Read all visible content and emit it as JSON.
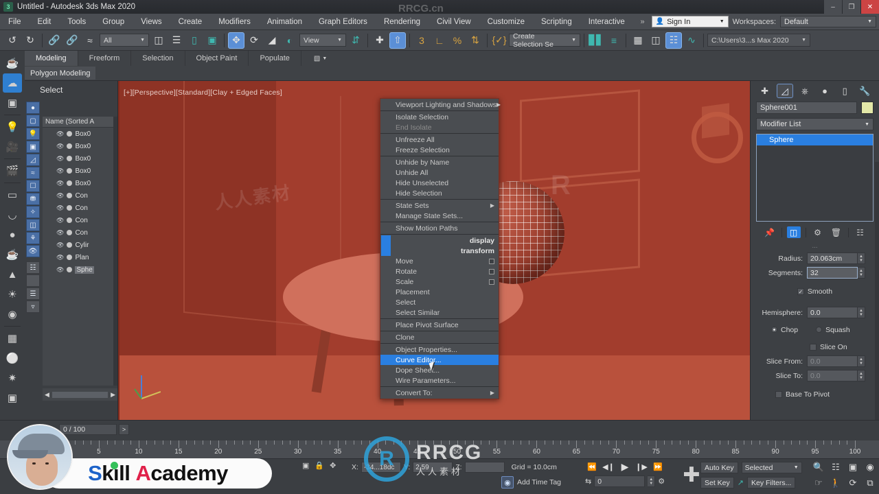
{
  "window": {
    "title": "Untitled - Autodesk 3ds Max 2020",
    "app_icon": "3",
    "minimize": "–",
    "maximize": "❐",
    "close": "✕"
  },
  "menubar": {
    "items": [
      "File",
      "Edit",
      "Tools",
      "Group",
      "Views",
      "Create",
      "Modifiers",
      "Animation",
      "Graph Editors",
      "Rendering",
      "Civil View",
      "Customize",
      "Scripting",
      "Interactive"
    ],
    "overflow": "»",
    "sign_in": "Sign In",
    "workspaces_label": "Workspaces:",
    "workspace_value": "Default"
  },
  "toolbar": {
    "selection_filter": "All",
    "reference_coord": "View",
    "selection_set": "Create Selection Se",
    "project_path": "C:\\Users\\3...s Max 2020",
    "icons": [
      "undo",
      "redo",
      "select-link",
      "unlink",
      "bind-space-warp",
      "select-object",
      "select-by-name",
      "rectangular-region",
      "window-crossing",
      "select-and-move",
      "select-and-rotate",
      "select-and-scale",
      "use-pivot-point",
      "use-center",
      "mirror",
      "align",
      "percent-snap",
      "angle-snap",
      "spinner-snap",
      "named-selection",
      "named-sets",
      "mirror-tool",
      "align-tool",
      "layer-explorer",
      "manage-layers",
      "material-editor",
      "curve-editor",
      "schematic-view"
    ]
  },
  "ribbon": {
    "tabs": [
      "Modeling",
      "Freeform",
      "Selection",
      "Object Paint",
      "Populate"
    ],
    "selected_tab": "Modeling",
    "panel_title": "Polygon Modeling"
  },
  "explorer": {
    "title": "Select",
    "column_header": "Name (Sorted A",
    "rows": [
      {
        "name": "Box0",
        "selected": false
      },
      {
        "name": "Box0",
        "selected": false
      },
      {
        "name": "Box0",
        "selected": false
      },
      {
        "name": "Box0",
        "selected": false
      },
      {
        "name": "Box0",
        "selected": false
      },
      {
        "name": "Con",
        "selected": false
      },
      {
        "name": "Con",
        "selected": false
      },
      {
        "name": "Con",
        "selected": false
      },
      {
        "name": "Con",
        "selected": false
      },
      {
        "name": "Cylir",
        "selected": false
      },
      {
        "name": "Plan",
        "selected": false
      },
      {
        "name": "Sphe",
        "selected": true
      }
    ]
  },
  "viewport": {
    "label": "[+][Perspective][Standard][Clay + Edged Faces]",
    "background_color": "#a23d2d"
  },
  "context_menu": {
    "highlight_color": "#2a7fe0",
    "items": [
      {
        "label": "Viewport Lighting and Shadows",
        "submenu": true,
        "dim": false
      },
      {
        "sep": true
      },
      {
        "label": "Isolate Selection",
        "dim": false
      },
      {
        "label": "End Isolate",
        "dim": true
      },
      {
        "sep": true
      },
      {
        "label": "Unfreeze All",
        "dim": false
      },
      {
        "label": "Freeze Selection",
        "dim": false
      },
      {
        "sep": true
      },
      {
        "label": "Unhide by Name",
        "dim": false
      },
      {
        "label": "Unhide All",
        "dim": false
      },
      {
        "label": "Hide Unselected",
        "dim": false
      },
      {
        "label": "Hide Selection",
        "dim": false
      },
      {
        "sep": true
      },
      {
        "label": "State Sets",
        "submenu": true,
        "dim": false
      },
      {
        "label": "Manage State Sets...",
        "dim": false
      },
      {
        "sep": true
      },
      {
        "label": "Show Motion Paths",
        "dim": false
      },
      {
        "sep": true
      },
      {
        "label": "display",
        "right": true
      },
      {
        "label": "transform",
        "right": true
      },
      {
        "label": "Move",
        "box": true,
        "dim": false
      },
      {
        "label": "Rotate",
        "box": true,
        "dim": false
      },
      {
        "label": "Scale",
        "box": true,
        "dim": false
      },
      {
        "label": "Placement",
        "dim": false
      },
      {
        "label": "Select",
        "dim": false
      },
      {
        "label": "Select Similar",
        "dim": false
      },
      {
        "sep": true
      },
      {
        "label": "Place Pivot Surface",
        "dim": false
      },
      {
        "sep": true
      },
      {
        "label": "Clone",
        "dim": false
      },
      {
        "sep": true
      },
      {
        "label": "Object Properties...",
        "dim": false
      },
      {
        "label": "Curve Editor...",
        "highlighted": true
      },
      {
        "label": "Dope Sheet...",
        "dim": false
      },
      {
        "label": "Wire Parameters...",
        "dim": false
      },
      {
        "sep": true
      },
      {
        "label": "Convert To:",
        "submenu": true,
        "dim": false
      }
    ]
  },
  "command_panel": {
    "tabs": [
      "create",
      "modify",
      "hierarchy",
      "motion",
      "display",
      "utilities"
    ],
    "selected_tab": "modify",
    "object_name": "Sphere001",
    "swatch_color": "#e3e8a8",
    "modifier_list_label": "Modifier List",
    "stack": [
      {
        "label": "Sphere",
        "selected": true
      }
    ],
    "parameters": {
      "radius_label": "Radius:",
      "radius_value": "20.063cm",
      "segments_label": "Segments:",
      "segments_value": "32",
      "smooth_label": "Smooth",
      "smooth_checked": true,
      "hemisphere_label": "Hemisphere:",
      "hemisphere_value": "0.0",
      "chop_label": "Chop",
      "chop_selected": true,
      "squash_label": "Squash",
      "squash_selected": false,
      "slice_on_label": "Slice On",
      "slice_on_checked": false,
      "slice_from_label": "Slice From:",
      "slice_from_value": "0.0",
      "slice_to_label": "Slice To:",
      "slice_to_value": "0.0",
      "base_to_pivot_label": "Base To Pivot",
      "base_to_pivot_checked": false
    }
  },
  "trackbar": {
    "frame_display": "0 / 100",
    "next_key": ">",
    "ruler_max": 100,
    "ruler_labels": [
      5,
      10,
      15,
      20,
      25,
      30,
      35,
      40,
      45,
      50,
      55,
      60,
      65,
      70,
      75,
      80,
      85,
      90,
      95,
      100
    ]
  },
  "statusbar": {
    "x_label": "X:",
    "x_value": "-34...18dc",
    "y_label": "Y:",
    "y_value": "2.59",
    "z_label": "Z:",
    "z_value": "",
    "grid_label": "Grid = 10.0cm",
    "add_time_tag": "Add Time Tag",
    "auto_key": "Auto Key",
    "set_key": "Set Key",
    "key_filters": "Key Filters...",
    "selection_level": "Selected",
    "current_frame": "0"
  },
  "overlays": {
    "brand_primary": "Skill",
    "brand_secondary": "Academy",
    "watermark_main": "RRCG",
    "watermark_sub": "人人素材",
    "watermark_top": "RRCG.cn"
  }
}
